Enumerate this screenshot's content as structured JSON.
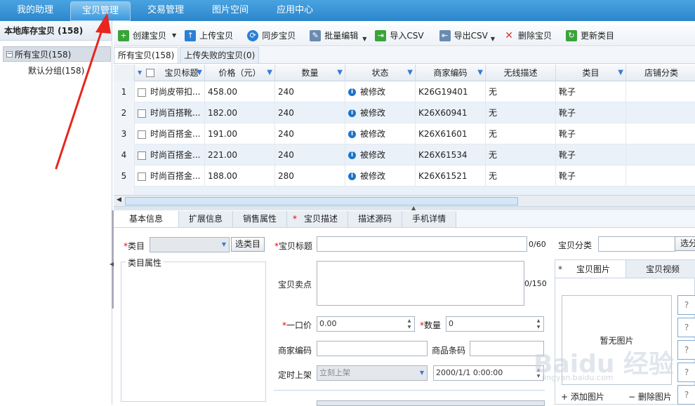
{
  "topnav": {
    "items": [
      "我的助理",
      "宝贝管理",
      "交易管理",
      "图片空间",
      "应用中心"
    ],
    "active_index": 1
  },
  "leftpanel": {
    "title": "本地库存宝贝 (158)",
    "tree_toggle": "−",
    "tree_root": "所有宝贝(158)",
    "tree_child": "默认分组(158)"
  },
  "toolbar": {
    "items": [
      {
        "label": "创建宝贝",
        "icon": "create-icon",
        "color": "#3aa33a",
        "glyph": "+"
      },
      {
        "label": "上传宝贝",
        "icon": "upload-icon",
        "color": "#2a7fd4",
        "glyph": "↑"
      },
      {
        "label": "同步宝贝",
        "icon": "sync-icon",
        "color": "#2a7fd4",
        "glyph": "⟳"
      },
      {
        "label": "批量编辑",
        "icon": "batch-edit-icon",
        "color": "#6a8bb0",
        "glyph": "✎"
      },
      {
        "label": "导入CSV",
        "icon": "import-csv-icon",
        "color": "#3aa33a",
        "glyph": "⇥"
      },
      {
        "label": "导出CSV",
        "icon": "export-csv-icon",
        "color": "#6a8bb0",
        "glyph": "⇤"
      },
      {
        "label": "删除宝贝",
        "icon": "delete-icon",
        "color": "#d23a3a",
        "glyph": "✕"
      },
      {
        "label": "更新类目",
        "icon": "update-category-icon",
        "color": "#3aa33a",
        "glyph": "↻"
      }
    ]
  },
  "list_tabs": [
    "所有宝贝(158)",
    "上传失败的宝贝(0)"
  ],
  "grid": {
    "columns": [
      "宝贝标题",
      "价格（元）",
      "数量",
      "状态",
      "商家编码",
      "无线描述",
      "类目",
      "店铺分类"
    ],
    "rows": [
      {
        "num": "1",
        "title": "时尚皮带扣...",
        "price": "458.00",
        "qty": "240",
        "status": "被修改",
        "code": "K26G19401",
        "wireless": "无",
        "category": "靴子",
        "shop_cat": ""
      },
      {
        "num": "2",
        "title": "时尚百搭靴...",
        "price": "182.00",
        "qty": "240",
        "status": "被修改",
        "code": "K26X60941",
        "wireless": "无",
        "category": "靴子",
        "shop_cat": ""
      },
      {
        "num": "3",
        "title": "时尚百搭金...",
        "price": "191.00",
        "qty": "240",
        "status": "被修改",
        "code": "K26X61601",
        "wireless": "无",
        "category": "靴子",
        "shop_cat": ""
      },
      {
        "num": "4",
        "title": "时尚百搭金...",
        "price": "221.00",
        "qty": "240",
        "status": "被修改",
        "code": "K26X61534",
        "wireless": "无",
        "category": "靴子",
        "shop_cat": ""
      },
      {
        "num": "5",
        "title": "时尚百搭金...",
        "price": "188.00",
        "qty": "280",
        "status": "被修改",
        "code": "K26X61521",
        "wireless": "无",
        "category": "靴子",
        "shop_cat": ""
      }
    ]
  },
  "detail_tabs": [
    {
      "label": "基本信息",
      "required": false
    },
    {
      "label": "扩展信息",
      "required": false
    },
    {
      "label": "销售属性",
      "required": false
    },
    {
      "label": "宝贝描述",
      "required": true
    },
    {
      "label": "描述源码",
      "required": false
    },
    {
      "label": "手机详情",
      "required": false
    }
  ],
  "form": {
    "req_mark": "*",
    "category_label": "类目",
    "select_category_btn": "选类目",
    "title_label": "宝贝标题",
    "title_counter": "0/60",
    "shop_category_label": "宝贝分类",
    "shop_category_btn": "选分",
    "attrs_legend": "类目属性",
    "selling_points_label": "宝贝卖点",
    "selling_points_counter": "0/150",
    "price_label": "一口价",
    "price_value": "0.00",
    "qty_label": "数量",
    "qty_value": "0",
    "merchant_code_label": "商家编码",
    "barcode_label": "商品条码",
    "schedule_label": "定时上架",
    "schedule_option": "立刻上架",
    "schedule_time": "2000/1/1 0:00:00"
  },
  "image_panel": {
    "tab_images": "宝贝图片",
    "tab_video": "宝贝视频",
    "no_image": "暂无图片",
    "add_image": "添加图片",
    "delete_image": "删除图片",
    "thumb_placeholder": "?"
  },
  "watermark": {
    "main": "Baidu 经验",
    "sub": "jingyan.baidu.com"
  },
  "colors": {
    "nav_bg": "#2b86cc",
    "annotation_arrow": "#e8261e",
    "row_alt": "#eaf1f9"
  }
}
